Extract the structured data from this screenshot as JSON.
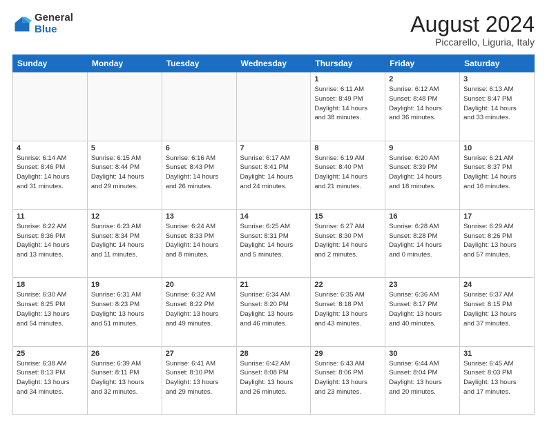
{
  "logo": {
    "general": "General",
    "blue": "Blue"
  },
  "header": {
    "title": "August 2024",
    "subtitle": "Piccarello, Liguria, Italy"
  },
  "days_of_week": [
    "Sunday",
    "Monday",
    "Tuesday",
    "Wednesday",
    "Thursday",
    "Friday",
    "Saturday"
  ],
  "weeks": [
    [
      {
        "day": "",
        "info": ""
      },
      {
        "day": "",
        "info": ""
      },
      {
        "day": "",
        "info": ""
      },
      {
        "day": "",
        "info": ""
      },
      {
        "day": "1",
        "info": "Sunrise: 6:11 AM\nSunset: 8:49 PM\nDaylight: 14 hours\nand 38 minutes."
      },
      {
        "day": "2",
        "info": "Sunrise: 6:12 AM\nSunset: 8:48 PM\nDaylight: 14 hours\nand 36 minutes."
      },
      {
        "day": "3",
        "info": "Sunrise: 6:13 AM\nSunset: 8:47 PM\nDaylight: 14 hours\nand 33 minutes."
      }
    ],
    [
      {
        "day": "4",
        "info": "Sunrise: 6:14 AM\nSunset: 8:46 PM\nDaylight: 14 hours\nand 31 minutes."
      },
      {
        "day": "5",
        "info": "Sunrise: 6:15 AM\nSunset: 8:44 PM\nDaylight: 14 hours\nand 29 minutes."
      },
      {
        "day": "6",
        "info": "Sunrise: 6:16 AM\nSunset: 8:43 PM\nDaylight: 14 hours\nand 26 minutes."
      },
      {
        "day": "7",
        "info": "Sunrise: 6:17 AM\nSunset: 8:41 PM\nDaylight: 14 hours\nand 24 minutes."
      },
      {
        "day": "8",
        "info": "Sunrise: 6:19 AM\nSunset: 8:40 PM\nDaylight: 14 hours\nand 21 minutes."
      },
      {
        "day": "9",
        "info": "Sunrise: 6:20 AM\nSunset: 8:39 PM\nDaylight: 14 hours\nand 18 minutes."
      },
      {
        "day": "10",
        "info": "Sunrise: 6:21 AM\nSunset: 8:37 PM\nDaylight: 14 hours\nand 16 minutes."
      }
    ],
    [
      {
        "day": "11",
        "info": "Sunrise: 6:22 AM\nSunset: 8:36 PM\nDaylight: 14 hours\nand 13 minutes."
      },
      {
        "day": "12",
        "info": "Sunrise: 6:23 AM\nSunset: 8:34 PM\nDaylight: 14 hours\nand 11 minutes."
      },
      {
        "day": "13",
        "info": "Sunrise: 6:24 AM\nSunset: 8:33 PM\nDaylight: 14 hours\nand 8 minutes."
      },
      {
        "day": "14",
        "info": "Sunrise: 6:25 AM\nSunset: 8:31 PM\nDaylight: 14 hours\nand 5 minutes."
      },
      {
        "day": "15",
        "info": "Sunrise: 6:27 AM\nSunset: 8:30 PM\nDaylight: 14 hours\nand 2 minutes."
      },
      {
        "day": "16",
        "info": "Sunrise: 6:28 AM\nSunset: 8:28 PM\nDaylight: 14 hours\nand 0 minutes."
      },
      {
        "day": "17",
        "info": "Sunrise: 6:29 AM\nSunset: 8:26 PM\nDaylight: 13 hours\nand 57 minutes."
      }
    ],
    [
      {
        "day": "18",
        "info": "Sunrise: 6:30 AM\nSunset: 8:25 PM\nDaylight: 13 hours\nand 54 minutes."
      },
      {
        "day": "19",
        "info": "Sunrise: 6:31 AM\nSunset: 8:23 PM\nDaylight: 13 hours\nand 51 minutes."
      },
      {
        "day": "20",
        "info": "Sunrise: 6:32 AM\nSunset: 8:22 PM\nDaylight: 13 hours\nand 49 minutes."
      },
      {
        "day": "21",
        "info": "Sunrise: 6:34 AM\nSunset: 8:20 PM\nDaylight: 13 hours\nand 46 minutes."
      },
      {
        "day": "22",
        "info": "Sunrise: 6:35 AM\nSunset: 8:18 PM\nDaylight: 13 hours\nand 43 minutes."
      },
      {
        "day": "23",
        "info": "Sunrise: 6:36 AM\nSunset: 8:17 PM\nDaylight: 13 hours\nand 40 minutes."
      },
      {
        "day": "24",
        "info": "Sunrise: 6:37 AM\nSunset: 8:15 PM\nDaylight: 13 hours\nand 37 minutes."
      }
    ],
    [
      {
        "day": "25",
        "info": "Sunrise: 6:38 AM\nSunset: 8:13 PM\nDaylight: 13 hours\nand 34 minutes."
      },
      {
        "day": "26",
        "info": "Sunrise: 6:39 AM\nSunset: 8:11 PM\nDaylight: 13 hours\nand 32 minutes."
      },
      {
        "day": "27",
        "info": "Sunrise: 6:41 AM\nSunset: 8:10 PM\nDaylight: 13 hours\nand 29 minutes."
      },
      {
        "day": "28",
        "info": "Sunrise: 6:42 AM\nSunset: 8:08 PM\nDaylight: 13 hours\nand 26 minutes."
      },
      {
        "day": "29",
        "info": "Sunrise: 6:43 AM\nSunset: 8:06 PM\nDaylight: 13 hours\nand 23 minutes."
      },
      {
        "day": "30",
        "info": "Sunrise: 6:44 AM\nSunset: 8:04 PM\nDaylight: 13 hours\nand 20 minutes."
      },
      {
        "day": "31",
        "info": "Sunrise: 6:45 AM\nSunset: 8:03 PM\nDaylight: 13 hours\nand 17 minutes."
      }
    ]
  ]
}
